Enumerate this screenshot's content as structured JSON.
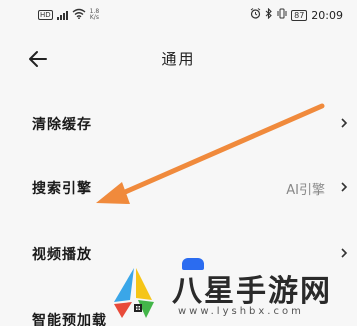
{
  "status_bar": {
    "hd_badge": "HD",
    "net_speed_value": "1.8",
    "net_speed_unit": "K/s",
    "battery": "87",
    "time": "20:09"
  },
  "header": {
    "title": "通用"
  },
  "settings": {
    "items": [
      {
        "label": "清除缓存",
        "value": ""
      },
      {
        "label": "搜索引擎",
        "value": "AI引擎"
      },
      {
        "label": "视频播放",
        "value": ""
      },
      {
        "label": "智能预加载",
        "value": ""
      }
    ]
  },
  "annotation": {
    "arrow_color": "#f08a3c"
  },
  "watermark": {
    "name": "八星手游网",
    "url": "www.lyshbx.com"
  },
  "colors": {
    "accent_orange": "#f08a3c",
    "text_primary": "#1a1a1a",
    "text_secondary": "#888888"
  }
}
